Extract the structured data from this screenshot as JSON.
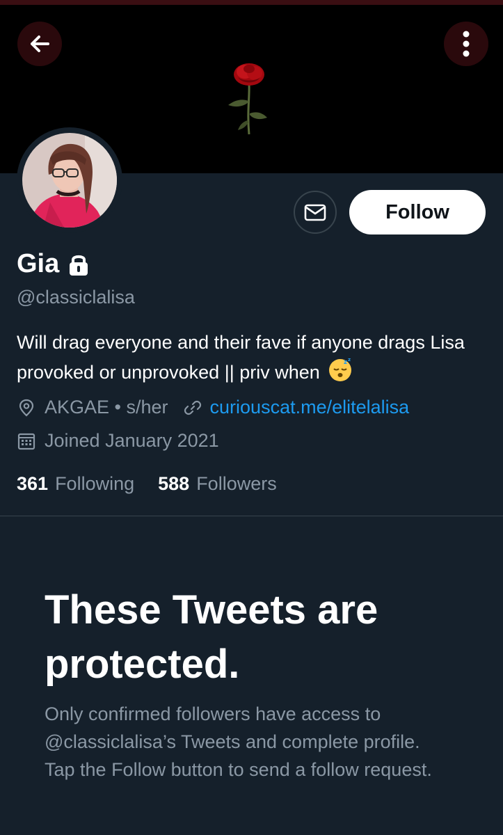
{
  "header": {
    "back_icon": "arrow-left-icon",
    "more_icon": "vertical-dots-icon",
    "banner_image": "red-rose"
  },
  "profile": {
    "name": "Gia",
    "protected_icon": "lock-icon",
    "handle": "@classiclalisa",
    "message_icon": "envelope-icon",
    "follow_label": "Follow",
    "bio": "Will drag everyone and their fave if anyone drags Lisa provoked or unprovoked || priv when",
    "bio_emoji": "sleeping-face-emoji",
    "location": "AKGAE • s/her",
    "link": "curiouscat.me/elitelalisa",
    "joined": "Joined January 2021",
    "following_count": "361",
    "following_label": "Following",
    "followers_count": "588",
    "followers_label": "Followers"
  },
  "protected_notice": {
    "title": "These Tweets are protected.",
    "body": "Only confirmed followers have access to @classiclalisa’s Tweets and complete profile. Tap the Follow button to send a follow request."
  },
  "colors": {
    "background": "#15202b",
    "banner": "#000000",
    "link": "#1d9bf0",
    "muted_text": "#8b98a5",
    "follow_button_bg": "#ffffff"
  }
}
